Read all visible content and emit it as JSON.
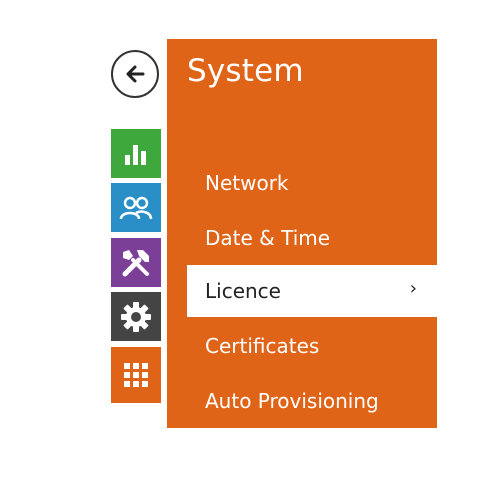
{
  "back": {
    "icon": "arrow-left-icon"
  },
  "nav_tiles": [
    {
      "name": "status",
      "icon": "bar-chart-icon",
      "color": "#3ea83d"
    },
    {
      "name": "directory",
      "icon": "users-icon",
      "color": "#2a8fc7"
    },
    {
      "name": "hardware",
      "icon": "tools-icon",
      "color": "#7b3f98"
    },
    {
      "name": "services",
      "icon": "gear-icon",
      "color": "#444444"
    },
    {
      "name": "system",
      "icon": "grid-icon",
      "color": "#e06418"
    }
  ],
  "panel": {
    "title": "System",
    "color": "#e06418",
    "items": [
      {
        "label": "Network"
      },
      {
        "label": "Date & Time"
      },
      {
        "label": "Licence",
        "selected": true,
        "chevron": "›"
      },
      {
        "label": "Certificates"
      },
      {
        "label": "Auto Provisioning"
      }
    ]
  }
}
